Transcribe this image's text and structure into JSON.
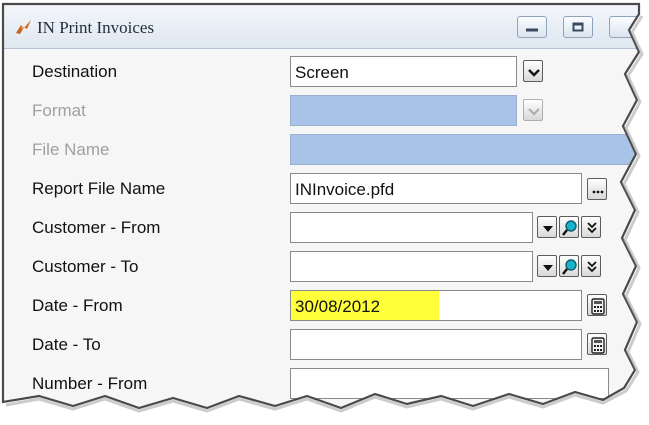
{
  "window": {
    "title": "IN Print Invoices"
  },
  "fields": {
    "destination": {
      "label": "Destination",
      "value": "Screen"
    },
    "format": {
      "label": "Format",
      "value": ""
    },
    "file_name": {
      "label": "File Name",
      "value": ""
    },
    "report_file_name": {
      "label": "Report File Name",
      "value": "INInvoice.pfd"
    },
    "customer_from": {
      "label": "Customer - From",
      "value": ""
    },
    "customer_to": {
      "label": "Customer - To",
      "value": ""
    },
    "date_from": {
      "label": "Date - From",
      "value": "30/08/2012"
    },
    "date_to": {
      "label": "Date - To",
      "value": ""
    },
    "number_from": {
      "label": "Number - From",
      "value": ""
    }
  },
  "icons": {
    "app": "bird-logo-icon",
    "minimize": "minimize-icon",
    "maximize": "maximize-icon",
    "dropdown": "chevron-down-icon",
    "browse": "ellipsis-icon",
    "search": "magnifier-icon",
    "expand": "double-chevron-down-icon",
    "calendar": "calculator-icon"
  },
  "colors": {
    "disabled_field": "#a9c3e8",
    "highlight": "#ffff3a",
    "search_icon": "#19b3c8",
    "disabled_text": "#a0a0a0"
  }
}
